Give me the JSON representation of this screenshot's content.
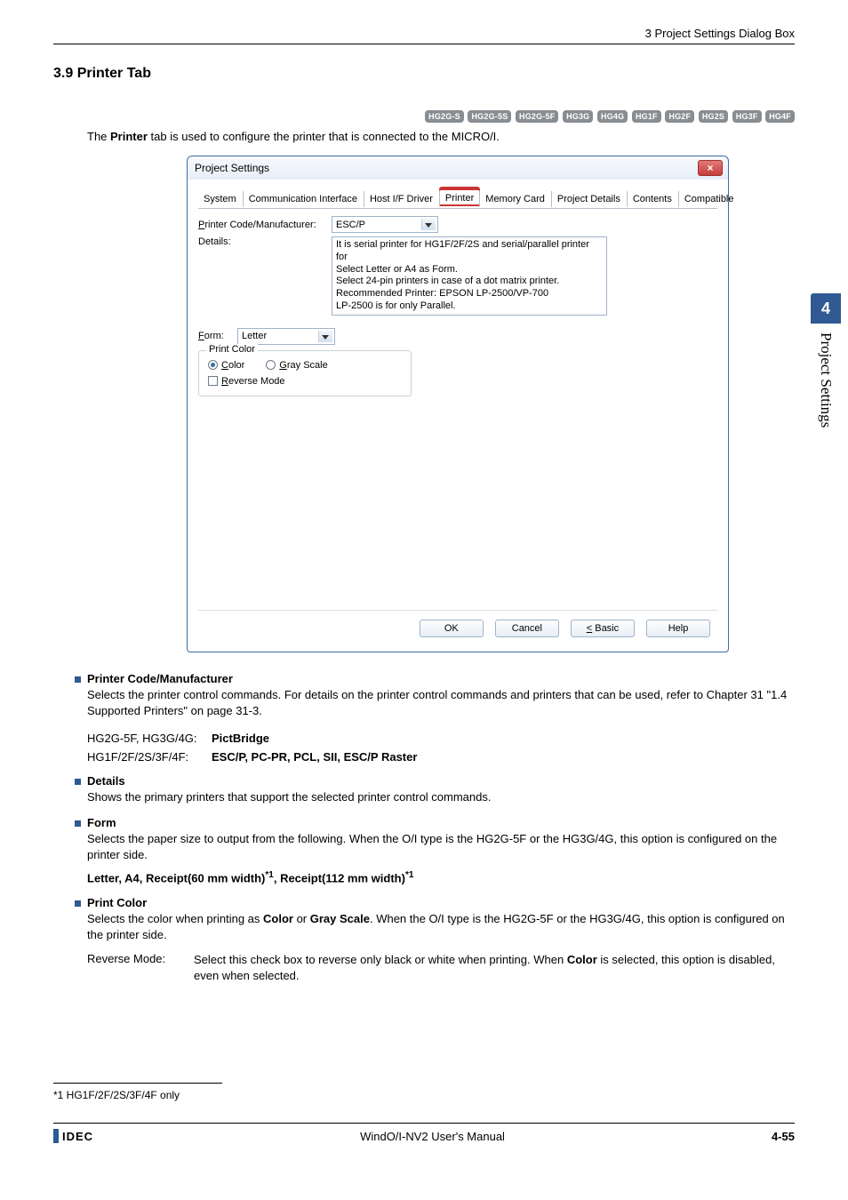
{
  "header": {
    "crumb": "3 Project Settings Dialog Box"
  },
  "section_title": "3.9   Printer Tab",
  "badges": [
    "HG2G-S",
    "HG2G-5S",
    "HG2G-5F",
    "HG3G",
    "HG4G",
    "HG1F",
    "HG2F",
    "HG2S",
    "HG3F",
    "HG4F"
  ],
  "intro": {
    "pre": "The ",
    "bold": "Printer",
    "post": " tab is used to configure the printer that is connected to the MICRO/I."
  },
  "dialog": {
    "title": "Project Settings",
    "close_label": "×",
    "tabs": [
      "System",
      "Communication Interface",
      "Host I/F Driver",
      "Printer",
      "Memory Card",
      "Project Details",
      "Contents",
      "Compatible"
    ],
    "active_tab_index": 3,
    "labels": {
      "printer_code": "Printer Code/Manufacturer:",
      "details": "Details:",
      "form": "Form:",
      "print_color": "Print Color",
      "color": "Color",
      "gray": "Gray Scale",
      "reverse": "Reverse Mode"
    },
    "values": {
      "printer_code": "ESC/P",
      "details_text": "It is serial printer for HG1F/2F/2S and serial/parallel printer for\nSelect Letter or A4 as Form.\nSelect 24-pin printers in case of a dot matrix printer.\nRecommended Printer: EPSON  LP-2500/VP-700\nLP-2500 is for only Parallel.",
      "form": "Letter",
      "color_selected": true,
      "reverse_checked": false
    },
    "buttons": {
      "ok": "OK",
      "cancel": "Cancel",
      "basic": "< Basic",
      "help": "Help"
    }
  },
  "def": {
    "pcm": {
      "head": "Printer Code/Manufacturer",
      "body": "Selects the printer control commands. For details on the printer control commands and printers that can be used, refer to Chapter 31 \"1.4 Supported Printers\" on page 31-3.",
      "rows": [
        {
          "k": "HG2G-5F, HG3G/4G:",
          "v": "PictBridge"
        },
        {
          "k": "HG1F/2F/2S/3F/4F:",
          "v": "ESC/P, PC-PR, PCL, SII, ESC/P Raster"
        }
      ]
    },
    "details": {
      "head": "Details",
      "body": "Shows the primary printers that support the selected printer control commands."
    },
    "form": {
      "head": "Form",
      "body": "Selects the paper size to output from the following. When the O/I type is the HG2G-5F or the HG3G/4G, this option is configured on the printer side.",
      "options_a": "Letter",
      "options_b": "A4",
      "options_c": "Receipt(60 mm width)",
      "sup1": "*1",
      "options_d": "Receipt(112 mm width)",
      "sup2": "*1"
    },
    "print_color": {
      "head": "Print Color",
      "body_pre": "Selects the color when printing as ",
      "b1": "Color",
      "mid": " or ",
      "b2": "Gray Scale",
      "body_post": ". When the O/I type is the HG2G-5F or the HG3G/4G, this option is configured on the printer side.",
      "rev_k": "Reverse Mode:",
      "rev_v_pre": "Select this check box to reverse only black or white when printing. When ",
      "rev_b": "Color",
      "rev_v_post": " is selected, this option is disabled, even when selected."
    }
  },
  "side": {
    "num": "4",
    "label": "Project Settings"
  },
  "footnote": "*1  HG1F/2F/2S/3F/4F only",
  "footer": {
    "brand": "IDEC",
    "manual": "WindO/I-NV2 User's Manual",
    "page_chap": "4-",
    "page_num": "55"
  }
}
